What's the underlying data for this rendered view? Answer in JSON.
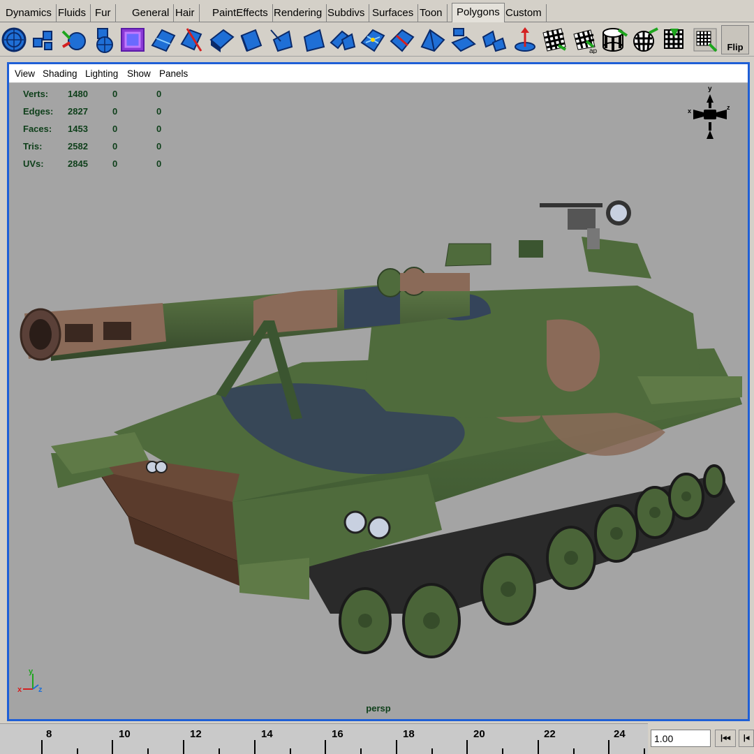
{
  "shelf": {
    "tabs": [
      {
        "label": "Dynamics",
        "active": false
      },
      {
        "label": "Fluids",
        "active": false
      },
      {
        "label": "Fur",
        "active": false
      },
      {
        "label": "General",
        "active": false
      },
      {
        "label": "Hair",
        "active": false
      },
      {
        "label": "PaintEffects",
        "active": false
      },
      {
        "label": "Rendering",
        "active": false
      },
      {
        "label": "Subdivs",
        "active": false
      },
      {
        "label": "Surfaces",
        "active": false
      },
      {
        "label": "Toon",
        "active": false
      },
      {
        "label": "Polygons",
        "active": true
      },
      {
        "label": "Custom",
        "active": false
      }
    ],
    "icons": [
      "polygon-sphere-icon",
      "combine-icon",
      "separate-icon",
      "smooth-icon",
      "cube-wire-icon",
      "split-polygon-icon",
      "cut-faces-icon",
      "extrude-face-icon",
      "extrude-edge-icon",
      "bevel-icon",
      "bridge-icon",
      "wedge-icon",
      "merge-vertices-icon",
      "split-edge-icon",
      "triangulate-icon",
      "quadrangulate-icon",
      "planar-map-icon",
      "collapse-icon",
      "center-pivot-icon",
      "uv-texture-editor-icon",
      "automatic-mapping-icon",
      "cylindrical-mapping-icon",
      "spherical-mapping-icon",
      "layout-uvs-icon",
      "checker-icon"
    ],
    "flip_label": "Flip",
    "icon_colors": {
      "primary": "#1f6fd6",
      "dark": "#0a2a6a",
      "light": "#8fd0ff",
      "arrow": "#d42020",
      "green": "#1ea51e"
    }
  },
  "panel": {
    "menu": [
      "View",
      "Shading",
      "Lighting",
      "Show",
      "Panels"
    ],
    "camera": "persp",
    "border_color": "#1f5fd6",
    "background": "#a4a4a4"
  },
  "hud": [
    {
      "label": "Verts:",
      "values": [
        "1480",
        "0",
        "0"
      ]
    },
    {
      "label": "Edges:",
      "values": [
        "2827",
        "0",
        "0"
      ]
    },
    {
      "label": "Faces:",
      "values": [
        "1453",
        "0",
        "0"
      ]
    },
    {
      "label": "Tris:",
      "values": [
        "2582",
        "0",
        "0"
      ]
    },
    {
      "label": "UVs:",
      "values": [
        "2845",
        "0",
        "0"
      ]
    }
  ],
  "view_cube": {
    "y": "y",
    "x": "x",
    "z": "z"
  },
  "axis_indicator": {
    "x": "x",
    "y": "y",
    "z": "z"
  },
  "timeline": {
    "ticks": [
      "8",
      "10",
      "12",
      "14",
      "16",
      "18",
      "20",
      "22",
      "24"
    ],
    "current_time": "1.00",
    "step_back_label": "|◂◂",
    "play_label": "|◂"
  },
  "model": {
    "name": "self-propelled artillery tank",
    "camo_colors": {
      "green": "#4f6b3c",
      "dark_green": "#3b5530",
      "blue": "#34445a",
      "tan": "#8a6a58",
      "wood": "#5a3b2c",
      "track": "#2a2a2a"
    }
  }
}
